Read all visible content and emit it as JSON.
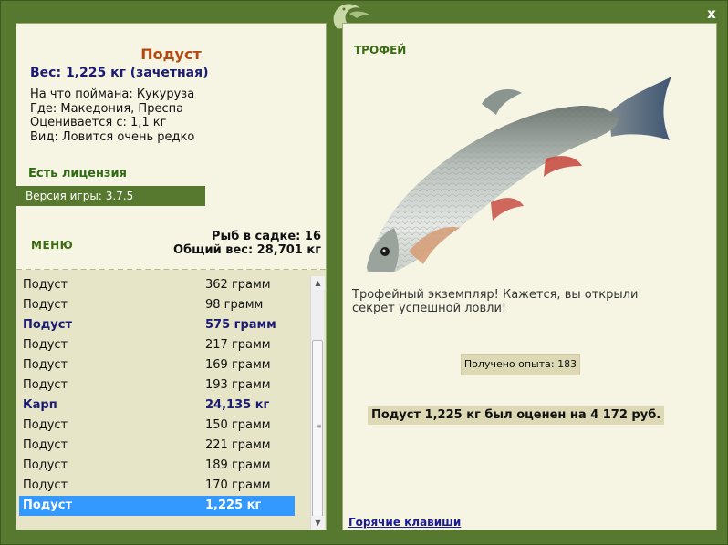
{
  "window": {
    "close_glyph": "x"
  },
  "fish_info": {
    "name": "Подуст",
    "weight_line": "Вес: 1,225 кг (зачетная)",
    "bait_line": "На что поймана: Кукуруза",
    "place_line": "Где: Македония, Преспа",
    "value_line": "Оценивается с: 1,1 кг",
    "rarity_line": "Вид: Ловится очень редко"
  },
  "license": "Есть лицензия",
  "version": "Версия игры: 3.7.5",
  "menu_label": "МЕНЮ",
  "stats": {
    "keepnet_line": "Рыб в садке: 16",
    "total_weight_line": "Общий вес: 28,701 кг"
  },
  "catch_list": [
    {
      "name": "Подуст",
      "weight": "362 грамм",
      "state": "normal"
    },
    {
      "name": "Подуст",
      "weight": "98 грамм",
      "state": "normal"
    },
    {
      "name": "Подуст",
      "weight": "575 грамм",
      "state": "trophy"
    },
    {
      "name": "Подуст",
      "weight": "217 грамм",
      "state": "normal"
    },
    {
      "name": "Подуст",
      "weight": "169 грамм",
      "state": "normal"
    },
    {
      "name": "Подуст",
      "weight": "193 грамм",
      "state": "normal"
    },
    {
      "name": "Карп",
      "weight": "24,135 кг",
      "state": "trophy"
    },
    {
      "name": "Подуст",
      "weight": "150 грамм",
      "state": "normal"
    },
    {
      "name": "Подуст",
      "weight": "221 грамм",
      "state": "normal"
    },
    {
      "name": "Подуст",
      "weight": "189 грамм",
      "state": "normal"
    },
    {
      "name": "Подуст",
      "weight": "170 грамм",
      "state": "normal"
    },
    {
      "name": "Подуст",
      "weight": "1,225 кг",
      "state": "selected"
    }
  ],
  "trophy_label": "ТРОФЕЙ",
  "trophy_message": "Трофейный экземпляр! Кажется, вы открыли секрет успешной ловли!",
  "xp_text": "Получено опыта: 183",
  "evaluation_text": "Подуст 1,225 кг был оценен на 4 172 руб.",
  "hotkeys_link": "Горячие клавиши",
  "colors": {
    "frame_green": "#56782f",
    "panel_bg": "#f6f5e4",
    "list_bg": "#e6e5c8",
    "title_orange": "#b5470f",
    "trophy_blue": "#1b1b73",
    "selected_blue": "#3399ff"
  },
  "icons": {
    "logo": "fish-logo-icon",
    "close": "close-icon",
    "scroll_up": "scroll-up-icon",
    "scroll_down": "scroll-down-icon"
  }
}
